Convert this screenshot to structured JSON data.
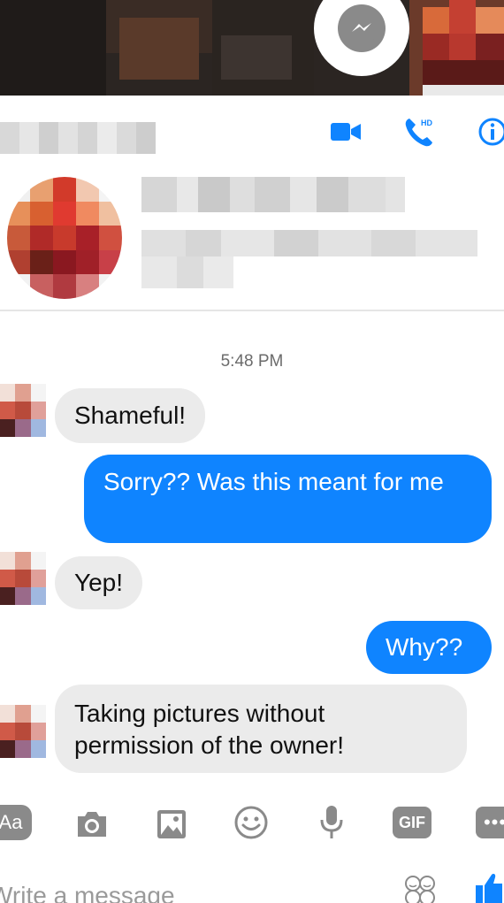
{
  "cover": {
    "messenger_icon": "messenger-icon"
  },
  "header": {
    "icons": [
      "video-call-icon",
      "phone-hd-icon",
      "info-icon"
    ],
    "hd_badge": "HD",
    "colors": {
      "accent": "#0f84ff"
    }
  },
  "thread": {
    "timestamp": "5:48 PM",
    "messages": [
      {
        "from": "them",
        "text": "Shameful!"
      },
      {
        "from": "me",
        "text": "Sorry?? Was this meant for me"
      },
      {
        "from": "them",
        "text": "Yep!"
      },
      {
        "from": "me",
        "text": "Why??"
      },
      {
        "from": "them",
        "text": "Taking pictures without permission of the owner!"
      }
    ]
  },
  "toolbar": {
    "aa_label": "Aa",
    "gif_label": "GIF",
    "more_label": "•••",
    "icons": [
      "text-format-icon",
      "camera-icon",
      "image-icon",
      "emoji-icon",
      "microphone-icon",
      "gif-icon",
      "more-icon"
    ]
  },
  "composer": {
    "placeholder": "Write a message",
    "icons": [
      "sticker-icon",
      "thumbs-up-icon"
    ]
  }
}
